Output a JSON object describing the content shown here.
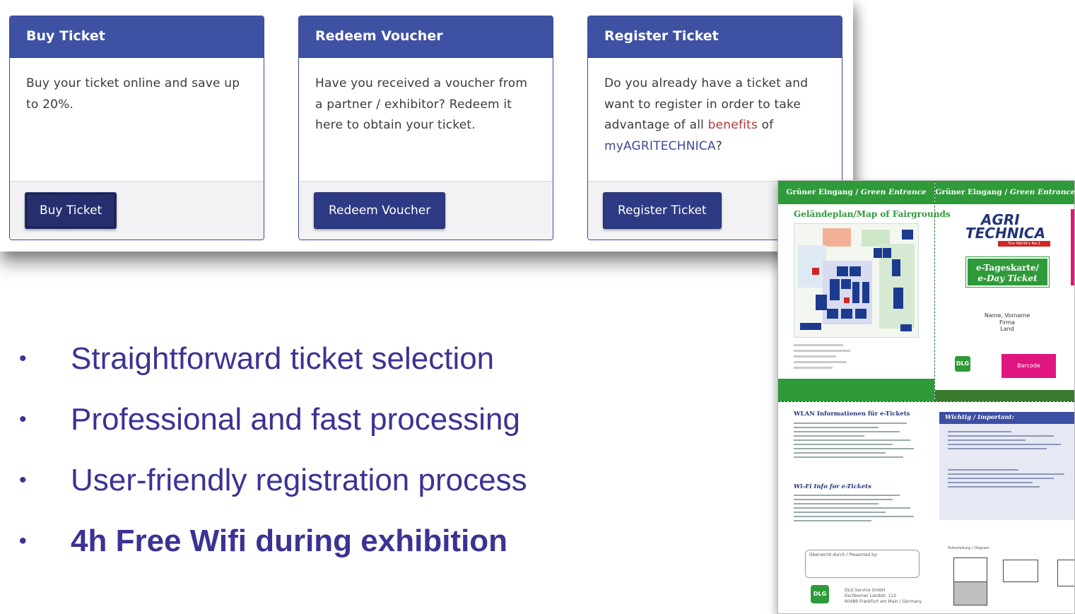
{
  "cards": [
    {
      "title": "Buy Ticket",
      "text": "Buy your ticket online and save up to 20%.",
      "button": "Buy Ticket"
    },
    {
      "title": "Redeem Voucher",
      "text": "Have you received a voucher from a partner / exhibitor? Redeem it here to obtain your ticket.",
      "button": "Redeem Voucher"
    },
    {
      "title": "Register Ticket",
      "text_before": "Do you already have a ticket and want to register in order to take advantage of all ",
      "link1": "benefits",
      "text_mid": " of ",
      "link2": "myAGRITECHNICA",
      "text_after": "?",
      "button": "Register Ticket"
    }
  ],
  "bullets": [
    "Straightforward ticket selection",
    "Professional and fast processing",
    "User-friendly registration process",
    "4h Free Wifi during exhibition"
  ],
  "bullet_glyph": "•",
  "ticket": {
    "header_de": "Grüner Eingang / ",
    "header_en": "Green Entrance",
    "map_title": "Geländeplan/Map of Fairgrounds",
    "logo_line1": "AGRI",
    "logo_line2": "TECHNICA",
    "logo_tag": "The World's No.1",
    "eday_line1": "e-Tageskarte/",
    "eday_line2": "e-Day Ticket",
    "name_line1": "Name, Vorname",
    "name_line2": "Firma",
    "name_line3": "Land",
    "dlg": "DLG",
    "barcode": "Barcode",
    "wlan_title": "WLAN Informationen für e-Tickets",
    "wifi_title": "Wi-Fi Info for e-Tickets",
    "presented_by": "Überreicht durch / Presented by:",
    "address_line1": "DLG Service GmbH",
    "address_line2": "Eschborner Landstr. 122",
    "address_line3": "60489 Frankfurt am Main / Germany",
    "important": "Wichtig / Important:",
    "diagram_label": "Faltanleitung / Diagram"
  },
  "colors": {
    "card_header": "#3f51a3",
    "button": "#2e3a83",
    "bullet_text": "#3b3393",
    "ticket_green": "#2e9a39",
    "barcode_pink": "#e0157f"
  }
}
